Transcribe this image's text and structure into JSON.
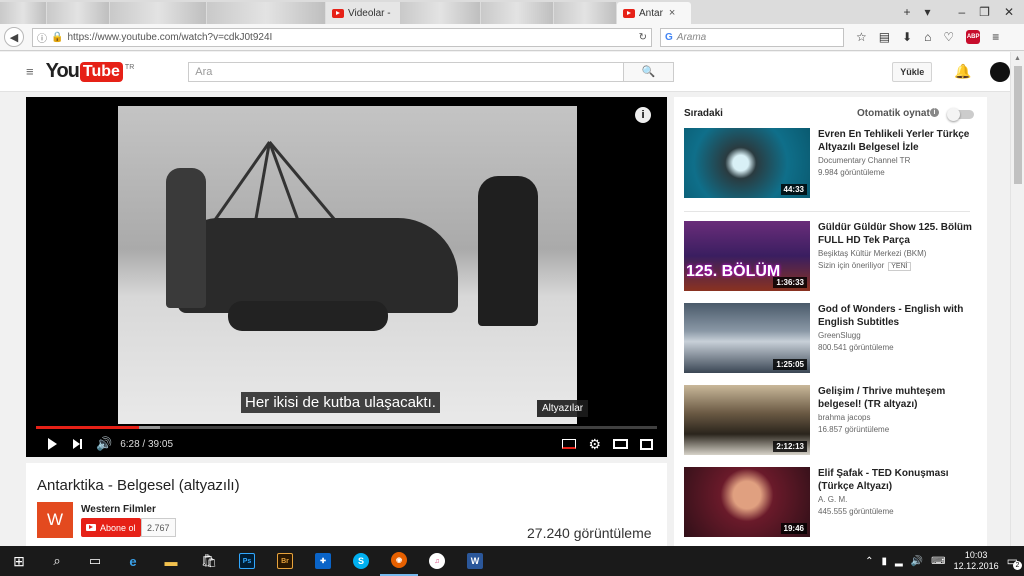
{
  "browser": {
    "tabs": [
      {
        "title": "",
        "blurred": true
      },
      {
        "title": "",
        "blurred": true
      },
      {
        "title": "",
        "blurred": true
      },
      {
        "title": "Videolar -",
        "blurred": false
      },
      {
        "title": "",
        "blurred": true
      },
      {
        "title": "",
        "blurred": true
      },
      {
        "title": "",
        "blurred": true
      },
      {
        "title": "Antar",
        "blurred": false,
        "active": true
      }
    ],
    "tab_close": "×",
    "new_tab": "+",
    "tab_menu": "▾",
    "window_controls": {
      "minimize": "–",
      "restore": "❐",
      "close": "✕"
    },
    "url": "https://www.youtube.com/watch?v=cdkJ0t924I",
    "search_placeholder": "Arama"
  },
  "youtube": {
    "logo_you": "You",
    "logo_tube": "Tube",
    "logo_region": "TR",
    "search_placeholder": "Ara",
    "upload_label": "Yükle"
  },
  "player": {
    "subtitle": "Her ikisi de kutba ulaşacaktı.",
    "cc_tooltip": "Altyazılar",
    "current_time": "6:28",
    "duration": "39:05",
    "progress_fraction": 0.166,
    "loaded_fraction": 0.2
  },
  "video": {
    "title": "Antarktika - Belgesel (altyazılı)",
    "channel_initial": "W",
    "channel_name": "Western Filmler",
    "subscribe_label": "Abone ol",
    "subscriber_count": "2.767",
    "views": "27.240 görüntüleme"
  },
  "sidebar": {
    "heading": "Sıradaki",
    "autoplay_label": "Otomatik oynat",
    "autoplay_info": "i",
    "items": [
      {
        "title": "Evren En Tehlikeli Yerler Türkçe Altyazılı Belgesel İzle",
        "channel": "Documentary Channel TR",
        "views": "9.984 görüntüleme",
        "duration": "44:33",
        "badge": "",
        "thumb_label": ""
      },
      {
        "title": "Güldür Güldür Show 125. Bölüm FULL HD Tek Parça",
        "channel": "Beşiktaş Kültür Merkezi (BKM)",
        "views": "Sizin için öneriliyor",
        "duration": "1:36:33",
        "badge": "YENİ",
        "thumb_label": "125. BÖLÜM"
      },
      {
        "title": "God of Wonders - English with English Subtitles",
        "channel": "GreenSlugg",
        "views": "800.541 görüntüleme",
        "duration": "1:25:05",
        "badge": "",
        "thumb_label": ""
      },
      {
        "title": "Gelişim / Thrive muhteşem belgesel! (TR altyazı)",
        "channel": "brahma jacops",
        "views": "16.857 görüntüleme",
        "duration": "2:12:13",
        "badge": "",
        "thumb_label": ""
      },
      {
        "title": "Elif Şafak - TED Konuşması (Türkçe Altyazı)",
        "channel": "A. G. M.",
        "views": "445.555 görüntüleme",
        "duration": "19:46",
        "badge": "",
        "thumb_label": ""
      }
    ]
  },
  "taskbar": {
    "time": "10:03",
    "date": "12.12.2016",
    "notification_count": "2",
    "apps": {
      "ps": "Ps",
      "br": "Br",
      "skype": "S",
      "word": "W"
    }
  },
  "colors": {
    "youtube_red": "#e62117",
    "channel_avatar": "#e34a1f"
  }
}
